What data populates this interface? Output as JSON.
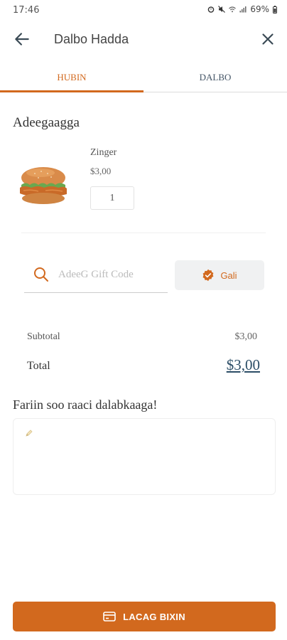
{
  "status_bar": {
    "time": "17:46",
    "battery": "69%",
    "icons": [
      "alarm-icon",
      "mute-icon",
      "wifi-icon",
      "signal-icon",
      "battery-icon"
    ]
  },
  "app_bar": {
    "title": "Dalbo Hadda",
    "back_icon": "arrow-left-icon",
    "close_icon": "close-icon"
  },
  "tabs": [
    {
      "label": "HUBIN",
      "active": true
    },
    {
      "label": "DALBO",
      "active": false
    }
  ],
  "cart": {
    "section_title": "Adeegaagga",
    "items": [
      {
        "name": "Zinger",
        "price": "$3,00",
        "quantity": "1",
        "image_icon": "burger-image"
      }
    ]
  },
  "gift": {
    "placeholder": "AdeeG Gift Code",
    "value": "",
    "apply_label": "Gali",
    "search_icon": "search-icon",
    "apply_icon": "verified-badge-icon"
  },
  "summary": {
    "subtotal_label": "Subtotal",
    "subtotal_value": "$3,00",
    "total_label": "Total",
    "total_value": "$3,00"
  },
  "comment": {
    "title": "Fariin soo raaci dalabkaaga!",
    "value": "",
    "icon": "pencil-icon"
  },
  "pay_button": {
    "label": "LACAG BIXIN",
    "icon": "credit-card-icon"
  },
  "colors": {
    "accent": "#d2691e",
    "total": "#2b4d66",
    "tab_inactive": "#445566"
  }
}
